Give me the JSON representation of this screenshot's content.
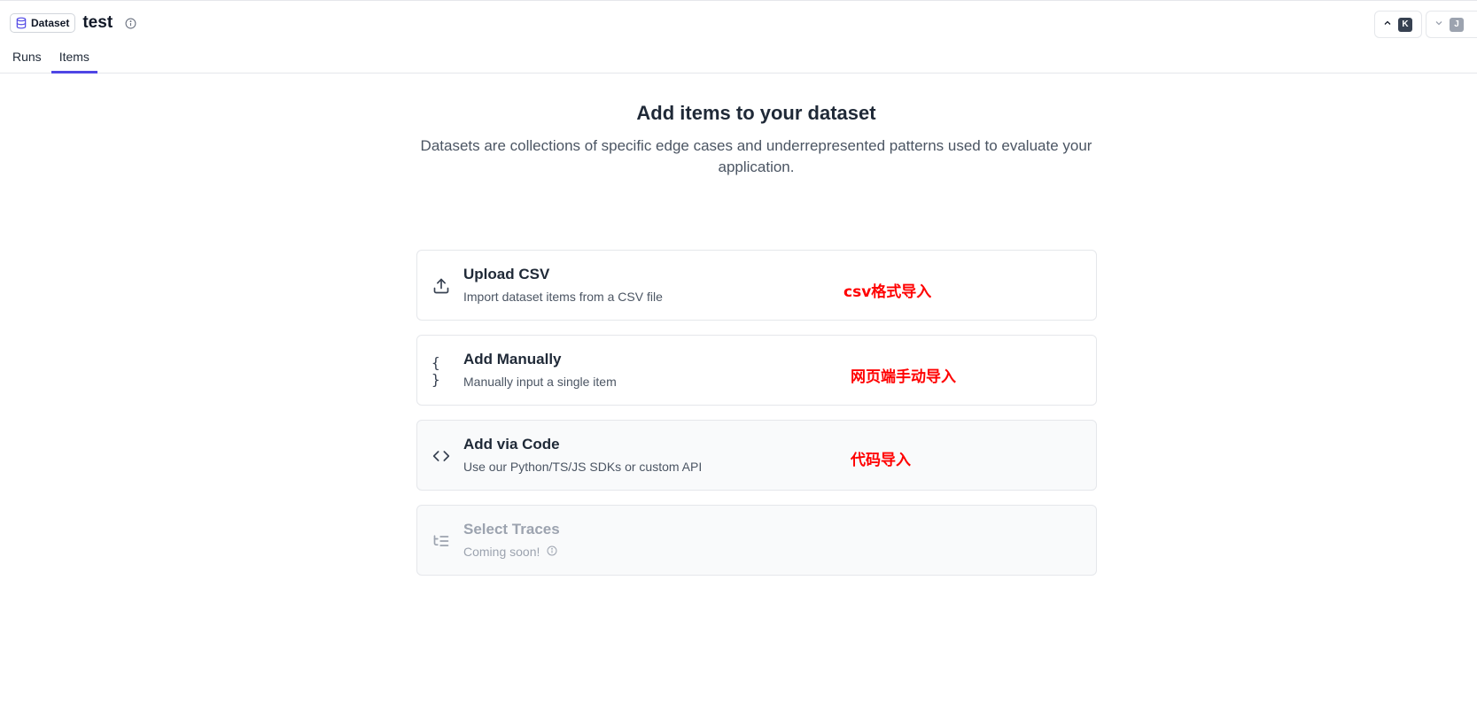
{
  "header": {
    "badge_label": "Dataset",
    "title": "test",
    "nav_up_key": "K",
    "nav_down_key": "J"
  },
  "tabs": [
    {
      "label": "Runs",
      "active": false
    },
    {
      "label": "Items",
      "active": true
    }
  ],
  "hero": {
    "title": "Add items to your dataset",
    "description": "Datasets are collections of specific edge cases and underrepresented patterns used to evaluate your application."
  },
  "cards": [
    {
      "icon": "upload-icon",
      "title": "Upload CSV",
      "description": "Import dataset items from a CSV file",
      "annotation": "csv格式导入"
    },
    {
      "icon": "braces-icon",
      "title": "Add Manually",
      "description": "Manually input a single item",
      "annotation": "网页端手动导入"
    },
    {
      "icon": "code-icon",
      "title": "Add via Code",
      "description": "Use our Python/TS/JS SDKs or custom API",
      "annotation": "代码导入"
    },
    {
      "icon": "list-tree-icon",
      "title": "Select Traces",
      "description": "Coming soon!",
      "disabled": true
    }
  ],
  "colors": {
    "accent": "#4f46e5",
    "annotation": "#ff0000"
  }
}
